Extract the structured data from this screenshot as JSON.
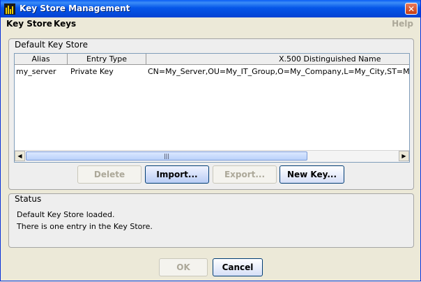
{
  "window": {
    "title": "Key Store Management",
    "close_glyph": "✕"
  },
  "menubar": {
    "items": [
      "Key Store",
      "Keys"
    ],
    "help": "Help"
  },
  "keystore": {
    "group_label": "Default Key Store",
    "columns": [
      "Alias",
      "Entry Type",
      "X.500 Distinguished Name"
    ],
    "rows": [
      [
        "my_server",
        "Private Key",
        "CN=My_Server,OU=My_IT_Group,O=My_Company,L=My_City,ST=My_"
      ]
    ],
    "scroll_thumb_glyph": "|||",
    "buttons": {
      "delete": "Delete",
      "import": "Import...",
      "export": "Export...",
      "new_key": "New Key..."
    }
  },
  "status": {
    "group_label": "Status",
    "lines": [
      "Default Key Store loaded.",
      "There is one entry in the Key Store."
    ]
  },
  "dialog": {
    "ok": "OK",
    "cancel": "Cancel"
  }
}
